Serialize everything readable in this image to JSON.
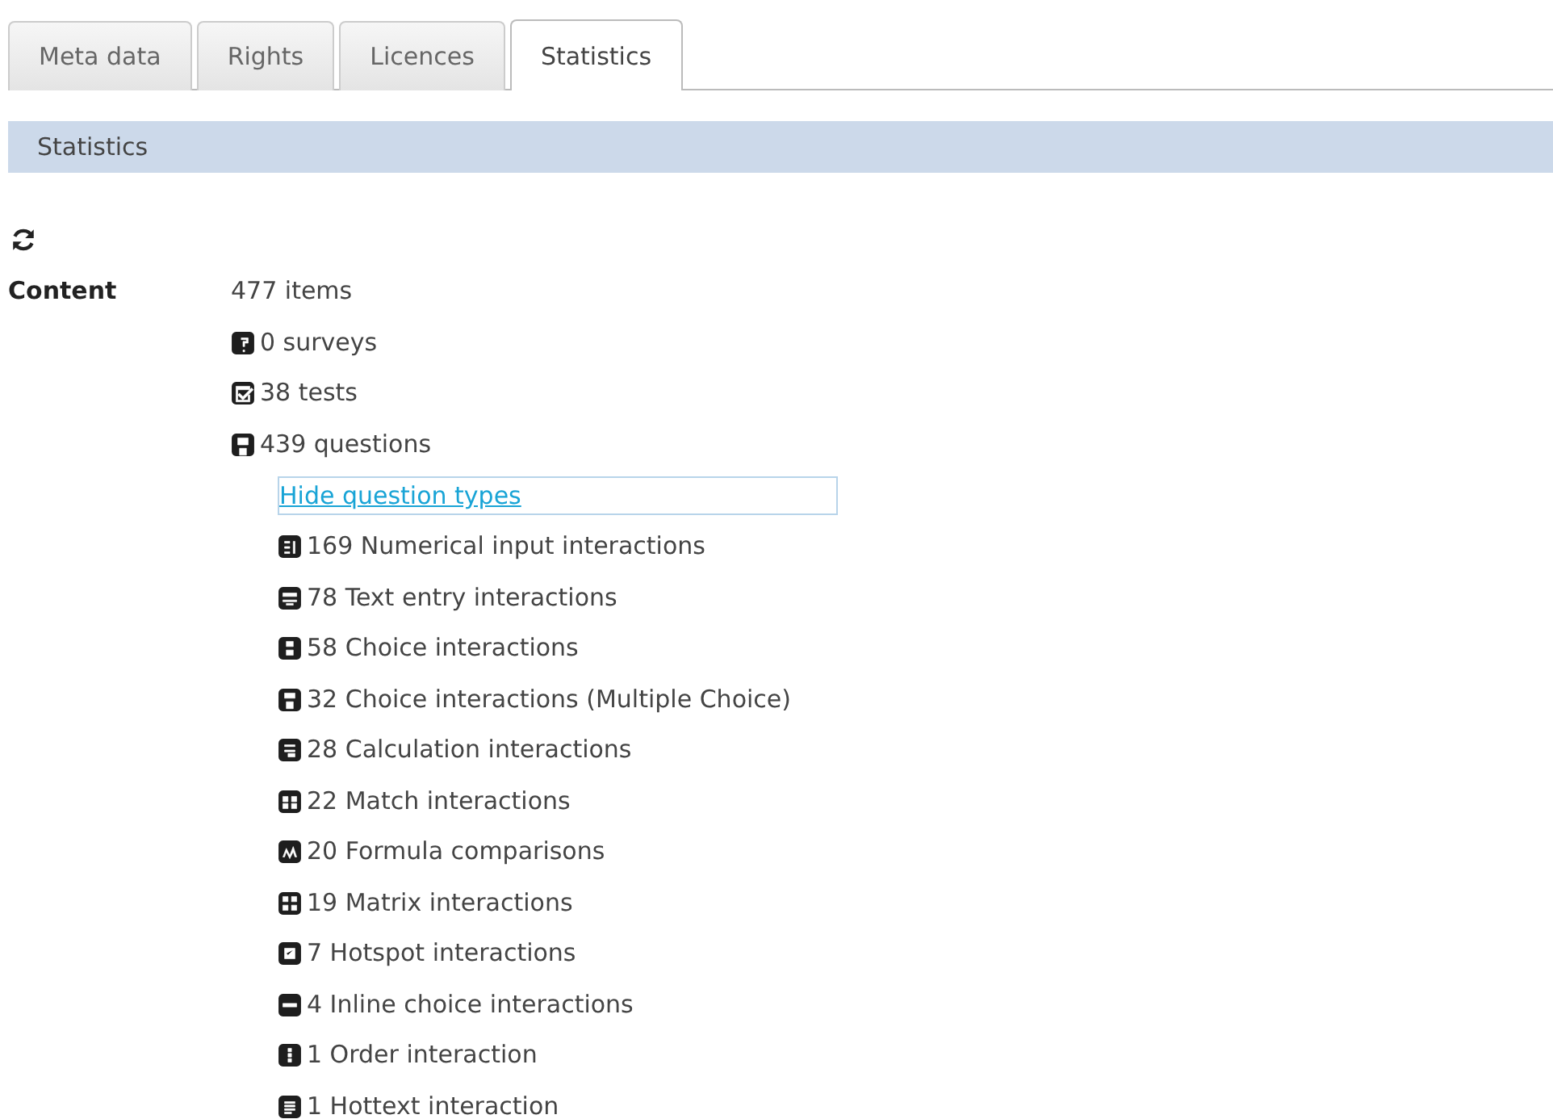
{
  "tabs": [
    {
      "label": "Meta data",
      "selected": false
    },
    {
      "label": "Rights",
      "selected": false
    },
    {
      "label": "Licences",
      "selected": false
    },
    {
      "label": "Statistics",
      "selected": true
    }
  ],
  "panel": {
    "title": "Statistics"
  },
  "content": {
    "label": "Content",
    "total": "477 items",
    "items": [
      {
        "kind": "survey",
        "text": "0 surveys"
      },
      {
        "kind": "test",
        "text": "38 tests"
      },
      {
        "kind": "question",
        "text": "439 questions"
      }
    ],
    "toggle_link": "Hide question types",
    "question_types": [
      {
        "kind": "numerical",
        "text": "169 Numerical input interactions"
      },
      {
        "kind": "textentry",
        "text": "78 Text entry interactions"
      },
      {
        "kind": "choice",
        "text": "58 Choice interactions"
      },
      {
        "kind": "multichoice",
        "text": "32 Choice interactions (Multiple Choice)"
      },
      {
        "kind": "calculation",
        "text": "28 Calculation interactions"
      },
      {
        "kind": "match",
        "text": "22 Match interactions"
      },
      {
        "kind": "formula",
        "text": "20 Formula comparisons"
      },
      {
        "kind": "matrix",
        "text": "19 Matrix interactions"
      },
      {
        "kind": "hotspot",
        "text": "7 Hotspot interactions"
      },
      {
        "kind": "inline",
        "text": "4 Inline choice interactions"
      },
      {
        "kind": "order",
        "text": "1 Order interaction"
      },
      {
        "kind": "hottext",
        "text": "1 Hottext interaction"
      }
    ]
  }
}
